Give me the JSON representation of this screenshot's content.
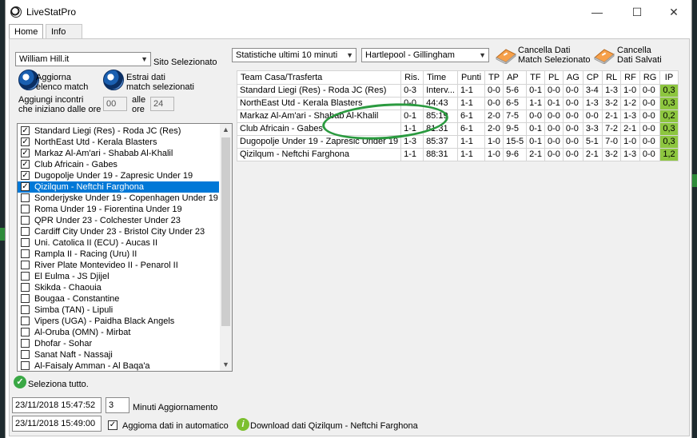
{
  "window": {
    "title": "LiveStatPro",
    "minimize": "—",
    "maximize": "☐",
    "close": "✕"
  },
  "tabs": [
    {
      "label": "Home"
    },
    {
      "label": "Info"
    }
  ],
  "left": {
    "bookmaker": "William Hill.it",
    "site_label": "Sito Selezionato",
    "update_label_1": "Aggiorna",
    "update_label_2": "elenco match",
    "extract_label_1": "Estrai dati",
    "extract_label_2": "match selezionati",
    "add_label_1": "Aggiungi incontri",
    "add_label_2": "che iniziano dalle ore",
    "from_hour": "00",
    "to_label_1": "alle",
    "to_label_2": "ore",
    "to_hour": "24",
    "select_all": "Seleziona tutto.",
    "timestamp_1": "23/11/2018 15:47:52",
    "minutes_value": "3",
    "minutes_label": "Minuti Aggiornamento",
    "timestamp_2": "23/11/2018 15:49:00",
    "auto_update_label": "Aggioma dati  in automatico",
    "download_label": "Download dati Qizilqum - Neftchi Farghona"
  },
  "matches": [
    {
      "label": "Standard Liegi (Res)  - Roda JC (Res)",
      "checked": true,
      "selected": false
    },
    {
      "label": "NorthEast Utd  - Kerala Blasters",
      "checked": true,
      "selected": false
    },
    {
      "label": "Markaz Al-Am'ari  - Shabab Al-Khalil",
      "checked": true,
      "selected": false
    },
    {
      "label": "Club Africain  - Gabes",
      "checked": true,
      "selected": false
    },
    {
      "label": "Dugopolje Under 19  - Zapresic Under 19",
      "checked": true,
      "selected": false
    },
    {
      "label": "Qizilqum  - Neftchi Farghona",
      "checked": true,
      "selected": true
    },
    {
      "label": "Sonderjyske Under 19  - Copenhagen Under 19",
      "checked": false,
      "selected": false
    },
    {
      "label": "Roma Under 19  - Fiorentina Under 19",
      "checked": false,
      "selected": false
    },
    {
      "label": "QPR Under 23  - Colchester Under 23",
      "checked": false,
      "selected": false
    },
    {
      "label": "Cardiff City Under 23  - Bristol City Under 23",
      "checked": false,
      "selected": false
    },
    {
      "label": "Uni. Catolica II (ECU)  - Aucas II",
      "checked": false,
      "selected": false
    },
    {
      "label": "Rampla II  - Racing (Uru) II",
      "checked": false,
      "selected": false
    },
    {
      "label": "River Plate Montevideo II  - Penarol II",
      "checked": false,
      "selected": false
    },
    {
      "label": "El Eulma  - JS Djijel",
      "checked": false,
      "selected": false
    },
    {
      "label": "Skikda  - Chaouia",
      "checked": false,
      "selected": false
    },
    {
      "label": "Bougaa  - Constantine",
      "checked": false,
      "selected": false
    },
    {
      "label": "Simba (TAN)  - Lipuli",
      "checked": false,
      "selected": false
    },
    {
      "label": "Vipers (UGA)  - Paidha Black Angels",
      "checked": false,
      "selected": false
    },
    {
      "label": "Al-Oruba (OMN)  - Mirbat",
      "checked": false,
      "selected": false
    },
    {
      "label": "Dhofar  - Sohar",
      "checked": false,
      "selected": false
    },
    {
      "label": "Sanat Naft  - Nassaji",
      "checked": false,
      "selected": false
    },
    {
      "label": "Al-Faisaly Amman  - Al Baqa'a",
      "checked": false,
      "selected": false
    }
  ],
  "right": {
    "stats_combo": "Statistiche ultimi 10 minuti",
    "match_combo": "Hartlepool - Gillingham",
    "clear_selected_1": "Cancella Dati",
    "clear_selected_2": "Match Selezionato",
    "clear_saved_1": "Cancella",
    "clear_saved_2": "Dati Salvati"
  },
  "grid": {
    "headers": [
      "Team Casa/Trasferta",
      "Ris.",
      "Time",
      "Punti",
      "TP",
      "AP",
      "TF",
      "PL",
      "AG",
      "CP",
      "RL",
      "RF",
      "RG",
      "IP"
    ],
    "rows": [
      [
        "Standard Liegi (Res) - Roda JC (Res)",
        "0-3",
        "Interv...",
        "1-1",
        "0-0",
        "5-6",
        "0-1",
        "0-0",
        "0-0",
        "3-4",
        "1-3",
        "1-0",
        "0-0",
        "0,3"
      ],
      [
        "NorthEast Utd - Kerala Blasters",
        "0-0",
        "44:43",
        "1-1",
        "0-0",
        "6-5",
        "1-1",
        "0-1",
        "0-0",
        "1-3",
        "3-2",
        "1-2",
        "0-0",
        "0,3"
      ],
      [
        "Markaz Al-Am'ari - Shabab Al-Khalil",
        "0-1",
        "85:19",
        "6-1",
        "2-0",
        "7-5",
        "0-0",
        "0-0",
        "0-0",
        "0-0",
        "2-1",
        "1-3",
        "0-0",
        "0,2"
      ],
      [
        "Club Africain - Gabes",
        "1-1",
        "81:31",
        "6-1",
        "2-0",
        "9-5",
        "0-1",
        "0-0",
        "0-0",
        "3-3",
        "7-2",
        "2-1",
        "0-0",
        "0,3"
      ],
      [
        "Dugopolje Under 19 - Zapresic Under 19",
        "1-3",
        "85:37",
        "1-1",
        "1-0",
        "15-5",
        "0-1",
        "0-0",
        "0-0",
        "5-1",
        "7-0",
        "1-0",
        "0-0",
        "0,3"
      ],
      [
        "Qizilqum - Neftchi Farghona",
        "1-1",
        "88:31",
        "1-1",
        "1-0",
        "9-6",
        "2-1",
        "0-0",
        "0-0",
        "2-1",
        "3-2",
        "1-3",
        "0-0",
        "1,2"
      ]
    ]
  },
  "colors": {
    "ip_cell": "#8dc63f",
    "annotation_oval": "#2a9a3f",
    "selection": "#0078d7"
  }
}
